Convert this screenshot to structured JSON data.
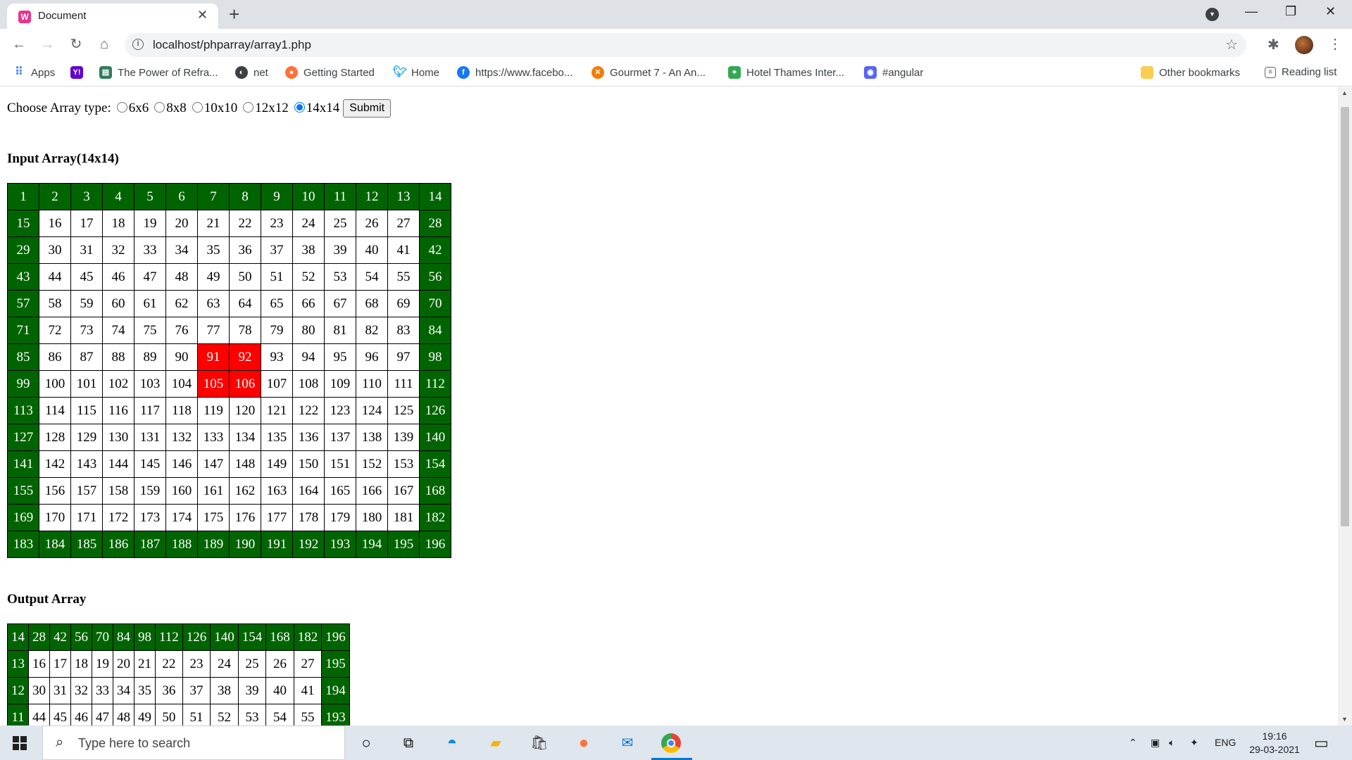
{
  "browser": {
    "tab_title": "Document",
    "tab_favicon_text": "W",
    "url": "localhost/phparray/array1.php"
  },
  "bookmarks": [
    {
      "label": "Apps",
      "icon": "apps-grid-icon",
      "color": "#4285f4"
    },
    {
      "label": "",
      "icon": "yahoo-icon",
      "color": "#6001d2"
    },
    {
      "label": "The Power of Refra...",
      "icon": "book-icon",
      "color": "#2e7d5b"
    },
    {
      "label": "net",
      "icon": "globe-icon",
      "color": "#3c4043"
    },
    {
      "label": "Getting Started",
      "icon": "firefox-icon",
      "color": "#ff7139"
    },
    {
      "label": "Home",
      "icon": "twitter-icon",
      "color": "#1da1f2"
    },
    {
      "label": "https://www.facebo...",
      "icon": "facebook-icon",
      "color": "#1877f2"
    },
    {
      "label": "Gourmet 7 - An An...",
      "icon": "food-icon",
      "color": "#f57c00"
    },
    {
      "label": "Hotel Thames Inter...",
      "icon": "maps-icon",
      "color": "#34a853"
    },
    {
      "label": "#angular",
      "icon": "discord-icon",
      "color": "#5865f2"
    },
    {
      "label": "Other bookmarks",
      "icon": "folder-icon",
      "color": "#f9ce52"
    },
    {
      "label": "Reading list",
      "icon": "reading-list-icon",
      "color": "#5f6368"
    }
  ],
  "form": {
    "label": "Choose Array type:",
    "options": [
      "6x6",
      "8x8",
      "10x10",
      "12x12",
      "14x14"
    ],
    "selected": "14x14",
    "submit_label": "Submit"
  },
  "input_array": {
    "heading": "Input Array(14x14)",
    "size": 14,
    "highlight": [
      91,
      92,
      105,
      106
    ],
    "colors": {
      "border": "#006400",
      "highlight": "#ff0000"
    }
  },
  "output_array": {
    "heading": "Output Array",
    "rows": [
      [
        14,
        28,
        42,
        56,
        70,
        84,
        98,
        112,
        126,
        140,
        154,
        168,
        182,
        196
      ],
      [
        13,
        16,
        17,
        18,
        19,
        20,
        21,
        22,
        23,
        24,
        25,
        26,
        27,
        195
      ],
      [
        12,
        30,
        31,
        32,
        33,
        34,
        35,
        36,
        37,
        38,
        39,
        40,
        41,
        194
      ],
      [
        11,
        44,
        45,
        46,
        47,
        48,
        49,
        50,
        51,
        52,
        53,
        54,
        55,
        193
      ]
    ]
  },
  "taskbar": {
    "search_placeholder": "Type here to search",
    "language": "ENG",
    "time": "19:16",
    "date": "29-03-2021"
  }
}
